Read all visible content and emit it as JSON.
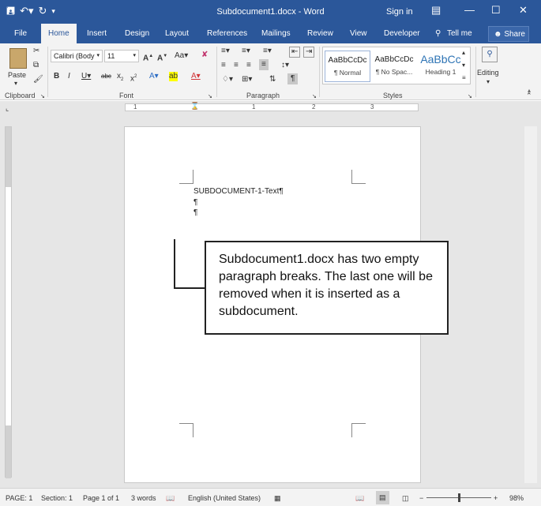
{
  "window": {
    "title": "Subdocument1.docx - Word",
    "sign_in": "Sign in",
    "qat_icons": [
      "save-icon",
      "undo-icon",
      "redo-icon",
      "customize-icon"
    ]
  },
  "tabs": [
    "File",
    "Home",
    "Insert",
    "Design",
    "Layout",
    "References",
    "Mailings",
    "Review",
    "View",
    "Developer"
  ],
  "tell_me": "Tell me",
  "share": "Share",
  "ribbon": {
    "clipboard": {
      "label": "Clipboard",
      "paste": "Paste"
    },
    "font": {
      "label": "Font",
      "family": "Calibri (Body",
      "size": "11"
    },
    "paragraph": {
      "label": "Paragraph"
    },
    "styles": {
      "label": "Styles",
      "items": [
        {
          "preview": "AaBbCcDc",
          "name": "¶ Normal"
        },
        {
          "preview": "AaBbCcDc",
          "name": "¶ No Spac..."
        },
        {
          "preview": "AaBbCc",
          "name": "Heading 1"
        }
      ]
    },
    "editing": {
      "label": "Editing"
    }
  },
  "ruler": {
    "marks": [
      "1",
      "1",
      "2",
      "3"
    ]
  },
  "document": {
    "line1": "SUBDOCUMENT-1-Text¶",
    "line2": "¶",
    "line3": "¶"
  },
  "callout": {
    "text": "Subdocument1.docx has two empty paragraph breaks. The last one will be removed when it is inserted as a subdocument."
  },
  "status": {
    "page": "PAGE: 1",
    "section": "Section: 1",
    "page_of": "Page 1 of 1",
    "words": "3 words",
    "language": "English (United States)",
    "zoom": "98%"
  },
  "colors": {
    "accent": "#2b579a",
    "ribbon_bg": "#f3f3f3",
    "canvas": "#e6e6e6"
  }
}
